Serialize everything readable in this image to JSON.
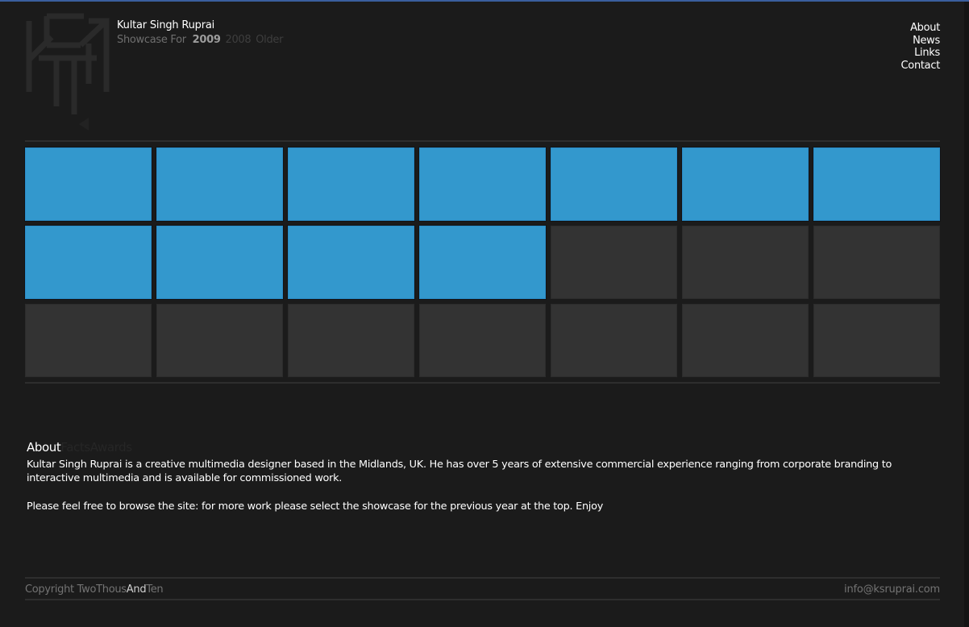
{
  "header": {
    "logo_icon": "ksr-monogram-logo",
    "title": "Kultar Singh Ruprai",
    "showcase": {
      "label": "Showcase For",
      "active_year": "2009",
      "other_years": [
        "2008",
        "Older"
      ]
    }
  },
  "nav": {
    "items": [
      {
        "label": "About"
      },
      {
        "label": "News"
      },
      {
        "label": "Links"
      },
      {
        "label": "Contact"
      }
    ]
  },
  "grid": {
    "columns": 7,
    "rows": 3,
    "filled_count": 11,
    "colors": {
      "filled": "#3398cd",
      "empty": "#333333"
    }
  },
  "about": {
    "tabs": [
      {
        "label": "About",
        "active": true
      },
      {
        "label": "Facts",
        "active": false
      },
      {
        "label": "Awards",
        "active": false
      }
    ],
    "paragraphs": [
      "Kultar Singh Ruprai is a creative multimedia designer based in the Midlands, UK. He has over 5 years of extensive commercial experience ranging from corporate branding to interactive multimedia and is available for commissioned work.",
      "Please feel free to browse the site: for more work please select the showcase for the previous year at the top. Enjoy"
    ]
  },
  "footer": {
    "copyright_prefix": "Copyright TwoThous",
    "copyright_highlight": "And",
    "copyright_suffix": "Ten",
    "email": "info@ksruprai.com"
  }
}
